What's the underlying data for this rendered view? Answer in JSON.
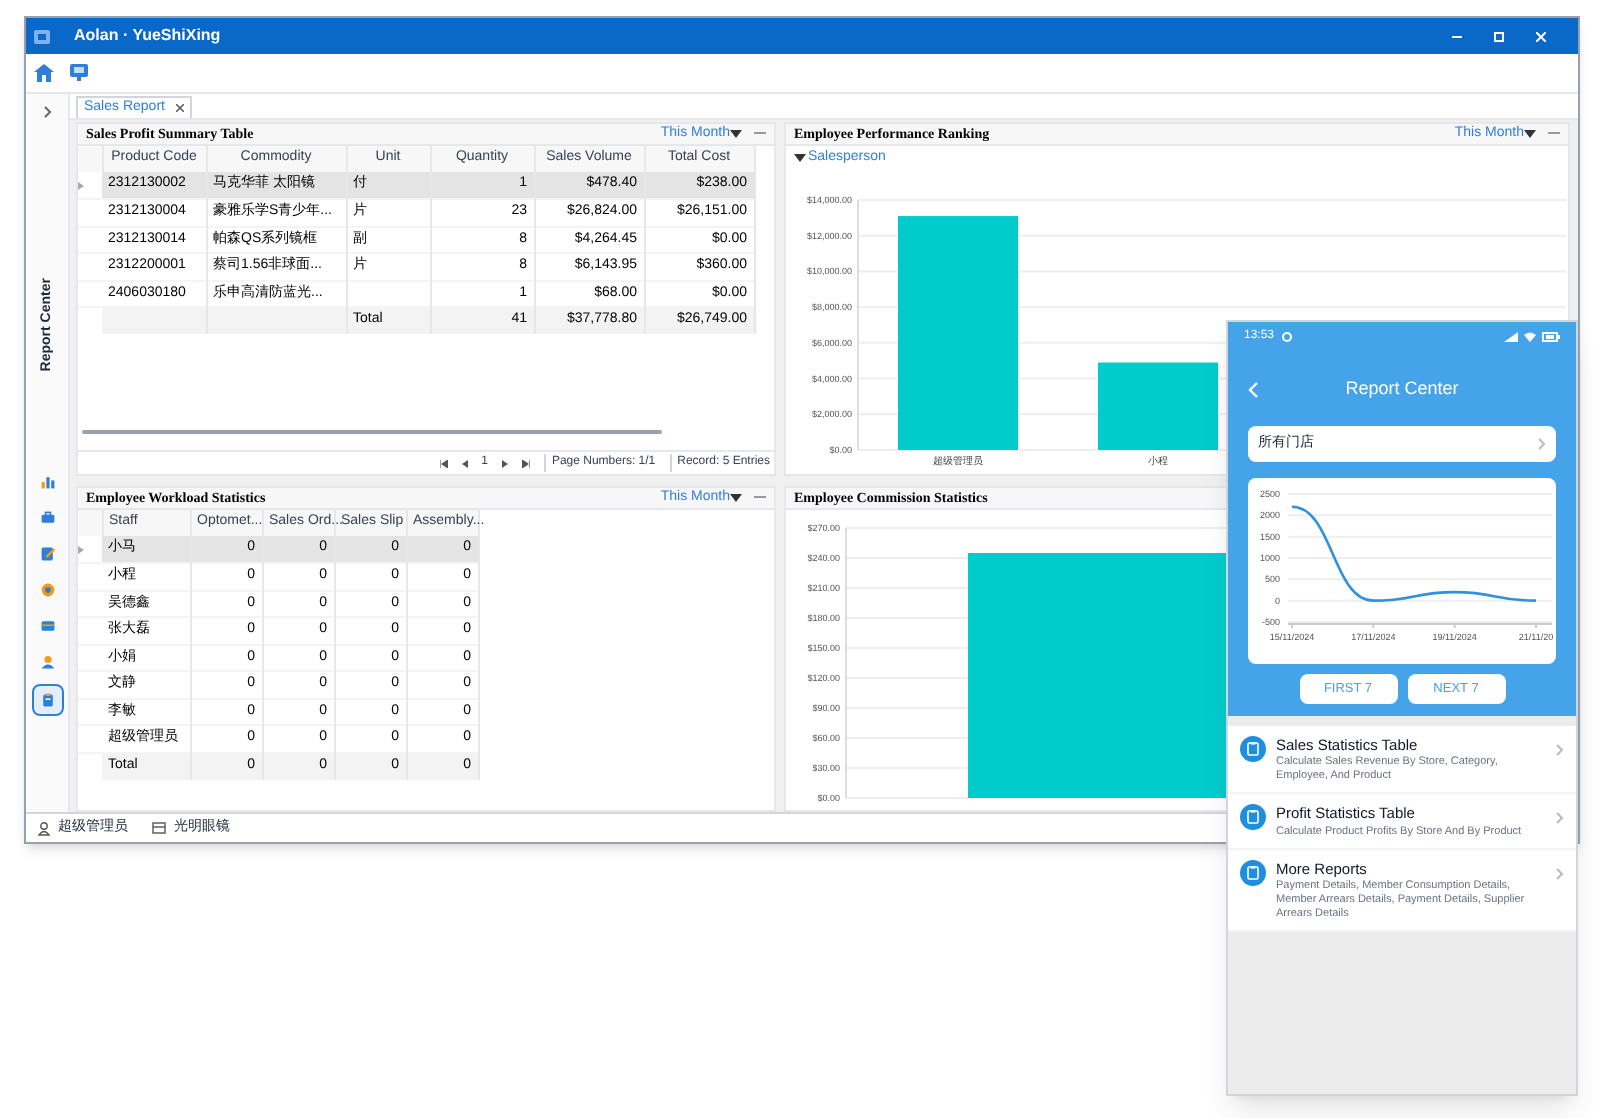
{
  "window": {
    "title": "Aolan · YueShiXing"
  },
  "sidebar": {
    "label": "Report Center",
    "items": [
      {
        "kind": "chart",
        "selected": false
      },
      {
        "kind": "case",
        "selected": false
      },
      {
        "kind": "edit",
        "selected": false
      },
      {
        "kind": "gear",
        "selected": false
      },
      {
        "kind": "box",
        "selected": false
      },
      {
        "kind": "user",
        "selected": false
      },
      {
        "kind": "report",
        "selected": true
      }
    ]
  },
  "tabs": [
    {
      "label": "Sales Report",
      "selected": true
    }
  ],
  "sales_table": {
    "title": "Sales Profit Summary Table",
    "period": "This Month",
    "columns": [
      "Product Code",
      "Commodity",
      "Unit",
      "Quantity",
      "Sales Volume",
      "Total Cost"
    ],
    "rows": [
      {
        "cells": [
          "2312130002",
          "马克华菲 太阳镜",
          "付",
          "1",
          "$478.40",
          "$238.00"
        ],
        "selected": true
      },
      {
        "cells": [
          "2312130004",
          "豪雅乐学S青少年...",
          "片",
          "23",
          "$26,824.00",
          "$26,151.00"
        ],
        "selected": false
      },
      {
        "cells": [
          "2312130014",
          "帕森QS系列镜框",
          "副",
          "8",
          "$4,264.45",
          "$0.00"
        ],
        "selected": false
      },
      {
        "cells": [
          "2312200001",
          "蔡司1.56非球面...",
          "片",
          "8",
          "$6,143.95",
          "$360.00"
        ],
        "selected": false
      },
      {
        "cells": [
          "2406030180",
          "乐申高清防蓝光...",
          "",
          "1",
          "$68.00",
          "$0.00"
        ],
        "selected": false
      }
    ],
    "total": {
      "label": "Total",
      "cells": [
        "41",
        "$37,778.80",
        "$26,749.00"
      ]
    },
    "page": "1",
    "page_numbers": "Page Numbers: 1/1",
    "record": "Record: 5 Entries"
  },
  "workload": {
    "title": "Employee Workload Statistics",
    "period": "This Month",
    "columns": [
      "Staff",
      "Optomet...",
      "Sales Ord...",
      "Sales Slip",
      "Assembly..."
    ],
    "rows": [
      {
        "cells": [
          "小马",
          "0",
          "0",
          "0",
          "0"
        ],
        "selected": true
      },
      {
        "cells": [
          "小程",
          "0",
          "0",
          "0",
          "0"
        ],
        "selected": false
      },
      {
        "cells": [
          "吴德鑫",
          "0",
          "0",
          "0",
          "0"
        ],
        "selected": false
      },
      {
        "cells": [
          "张大磊",
          "0",
          "0",
          "0",
          "0"
        ],
        "selected": false
      },
      {
        "cells": [
          "小娟",
          "0",
          "0",
          "0",
          "0"
        ],
        "selected": false
      },
      {
        "cells": [
          "文静",
          "0",
          "0",
          "0",
          "0"
        ],
        "selected": false
      },
      {
        "cells": [
          "李敏",
          "0",
          "0",
          "0",
          "0"
        ],
        "selected": false
      },
      {
        "cells": [
          "超级管理员",
          "0",
          "0",
          "0",
          "0"
        ],
        "selected": false
      }
    ],
    "total": {
      "label": "Total",
      "cells": [
        "0",
        "0",
        "0",
        "0"
      ]
    }
  },
  "performance": {
    "title": "Employee Performance Ranking",
    "period": "This Month",
    "filter": "Salesperson",
    "chart_data": {
      "type": "bar",
      "grid": true,
      "categories": [
        "超级管理员",
        "小程"
      ],
      "values": [
        13100,
        4900
      ],
      "ylim": [
        0,
        14000
      ],
      "yticks": [
        {
          "value": 0,
          "label": "$0.00"
        },
        {
          "value": 2000,
          "label": "$2,000.00"
        },
        {
          "value": 4000,
          "label": "$4,000.00"
        },
        {
          "value": 6000,
          "label": "$6,000.00"
        },
        {
          "value": 8000,
          "label": "$8,000.00"
        },
        {
          "value": 10000,
          "label": "$10,000.00"
        },
        {
          "value": 12000,
          "label": "$12,000.00"
        },
        {
          "value": 14000,
          "label": "$14,000.00"
        }
      ]
    }
  },
  "commission": {
    "title": "Employee Commission Statistics",
    "chart_data": {
      "type": "bar",
      "grid": true,
      "values": [
        245
      ],
      "ylim": [
        0,
        270
      ],
      "yticks": [
        {
          "value": 0,
          "label": "$0.00"
        },
        {
          "value": 30,
          "label": "$30.00"
        },
        {
          "value": 60,
          "label": "$60.00"
        },
        {
          "value": 90,
          "label": "$90.00"
        },
        {
          "value": 120,
          "label": "$120.00"
        },
        {
          "value": 150,
          "label": "$150.00"
        },
        {
          "value": 180,
          "label": "$180.00"
        },
        {
          "value": 210,
          "label": "$210.00"
        },
        {
          "value": 240,
          "label": "$240.00"
        },
        {
          "value": 270,
          "label": "$270.00"
        }
      ]
    }
  },
  "status_bar": [
    {
      "kind": "user",
      "text": "超级管理员"
    },
    {
      "kind": "store",
      "text": "光明眼镜"
    }
  ],
  "phone": {
    "time": "13:53",
    "title": "Report Center",
    "store": "所有门店",
    "chart_data": {
      "type": "line",
      "grid": true,
      "x": [
        "15/11/2024",
        "17/11/2024",
        "19/11/2024",
        "21/11/20"
      ],
      "series": [
        {
          "color": "#2f8fe0",
          "values": [
            2200,
            0,
            200,
            0
          ]
        }
      ],
      "ylim": [
        -500,
        2500
      ],
      "yticks": [
        -500,
        0,
        500,
        1000,
        1500,
        2000,
        2500
      ]
    },
    "buttons": [
      "FIRST 7",
      "NEXT 7"
    ],
    "reports": [
      {
        "title": "Sales Statistics Table",
        "description": "Calculate Sales Revenue By Store, Category, Employee, And Product"
      },
      {
        "title": "Profit Statistics Table",
        "description": "Calculate Product Profits By Store And By Product"
      },
      {
        "title": "More Reports",
        "description": "Payment Details, Member Consumption Details, Member Arrears Details, Payment Details, Supplier Arrears Details"
      }
    ]
  }
}
